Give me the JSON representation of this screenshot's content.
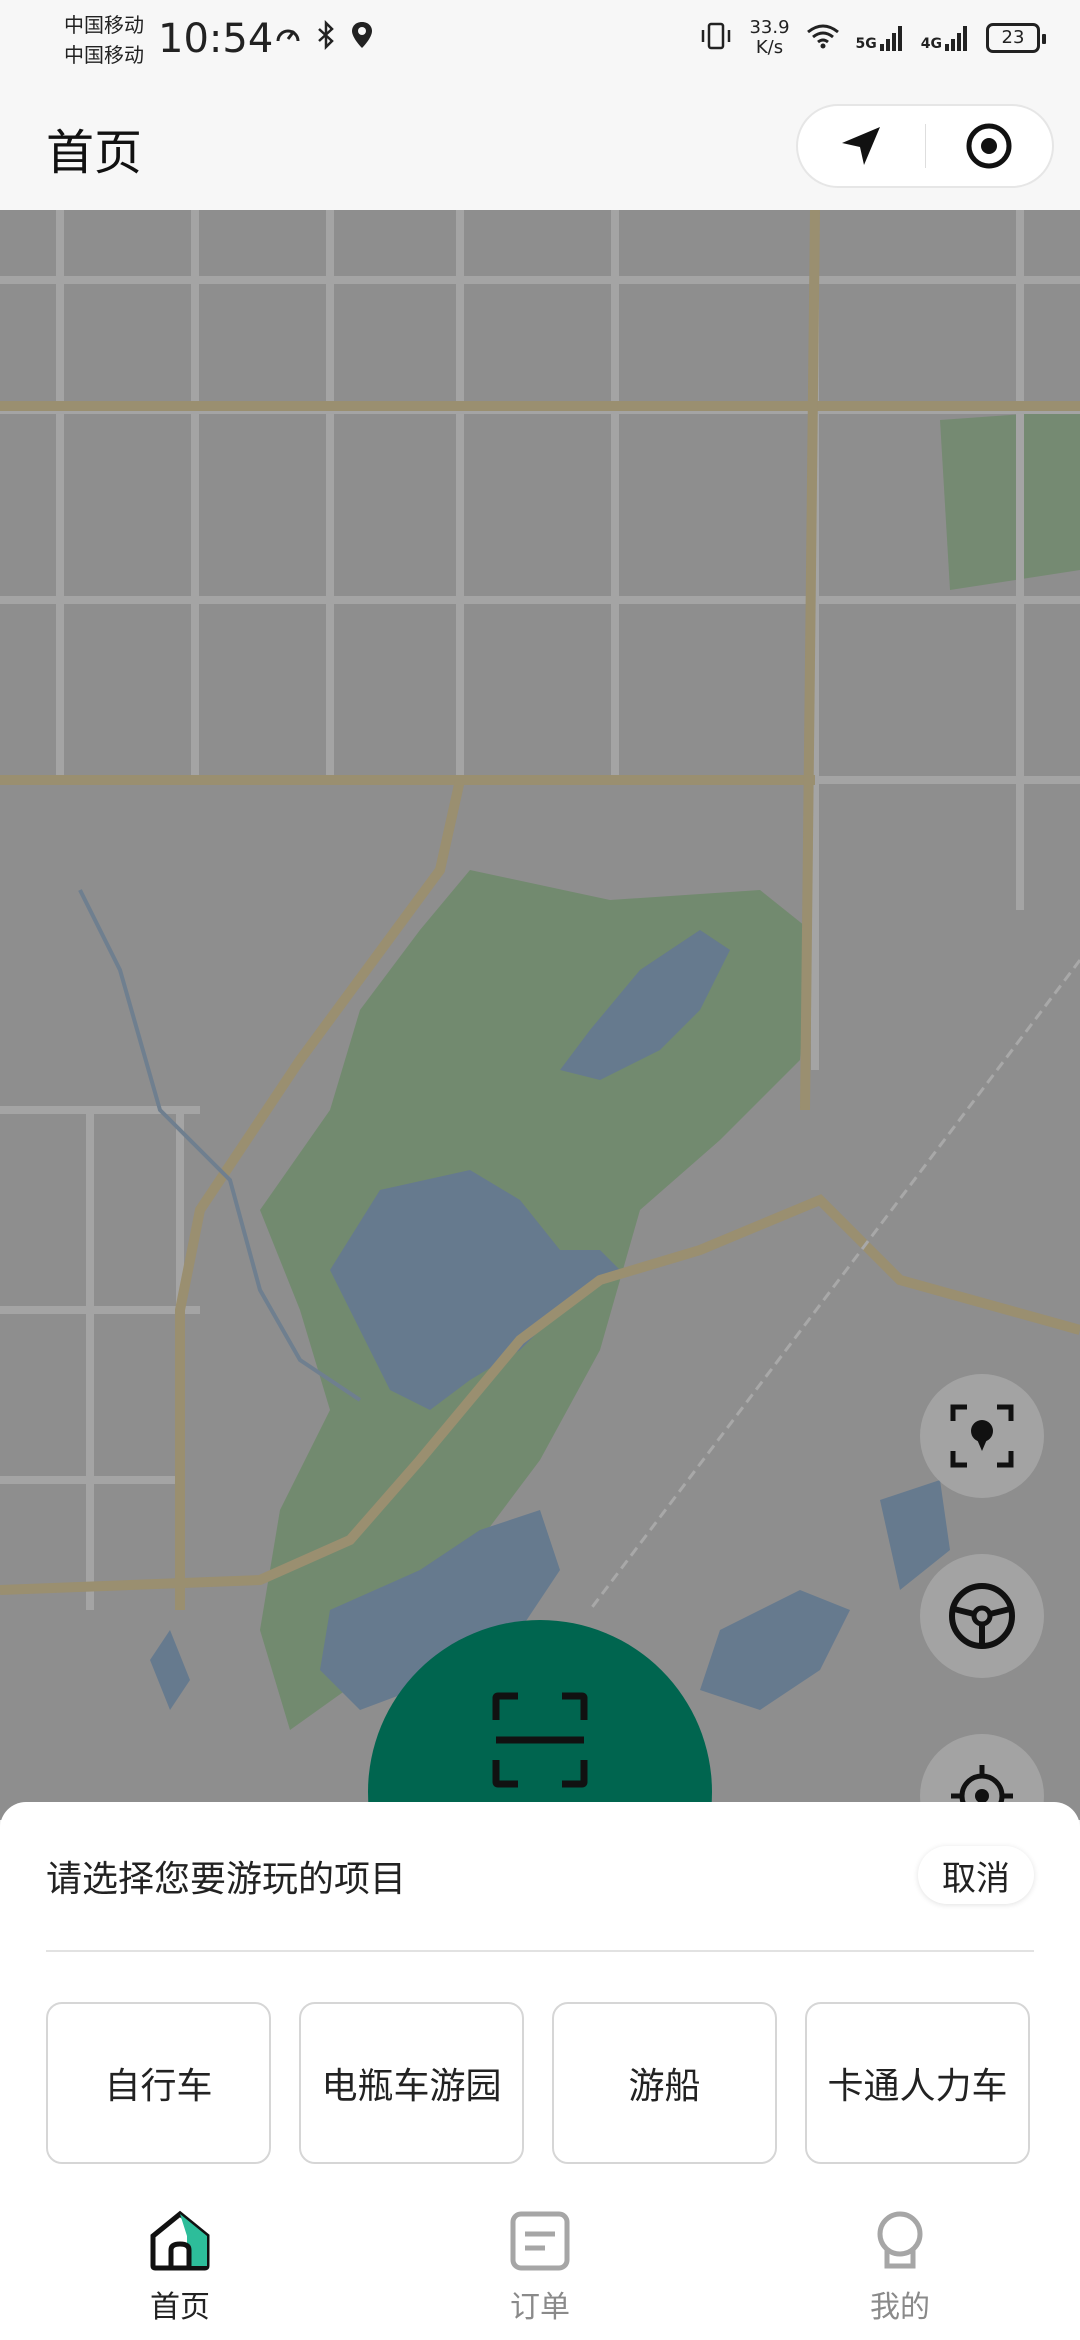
{
  "status_bar": {
    "carrier_1": "中国移动",
    "carrier_2": "中国移动",
    "time": "10:54",
    "net_speed_value": "33.9",
    "net_speed_unit": "K/s",
    "signal_1": "5G",
    "signal_2": "4G",
    "battery": "23"
  },
  "header": {
    "title": "首页"
  },
  "colors": {
    "accent": "#00654f",
    "map_overlay": "#8c8c8c"
  },
  "map_controls": [
    "scan-location-icon",
    "steering-wheel-icon",
    "locate-crosshair-icon"
  ],
  "sheet": {
    "title": "请选择您要游玩的项目",
    "cancel_label": "取消",
    "options": [
      "自行车",
      "电瓶车游园",
      "游船",
      "卡通人力车"
    ]
  },
  "tabbar": {
    "items": [
      {
        "label": "首页",
        "icon": "home-icon",
        "active": true
      },
      {
        "label": "订单",
        "icon": "order-icon",
        "active": false
      },
      {
        "label": "我的",
        "icon": "profile-icon",
        "active": false
      }
    ]
  }
}
